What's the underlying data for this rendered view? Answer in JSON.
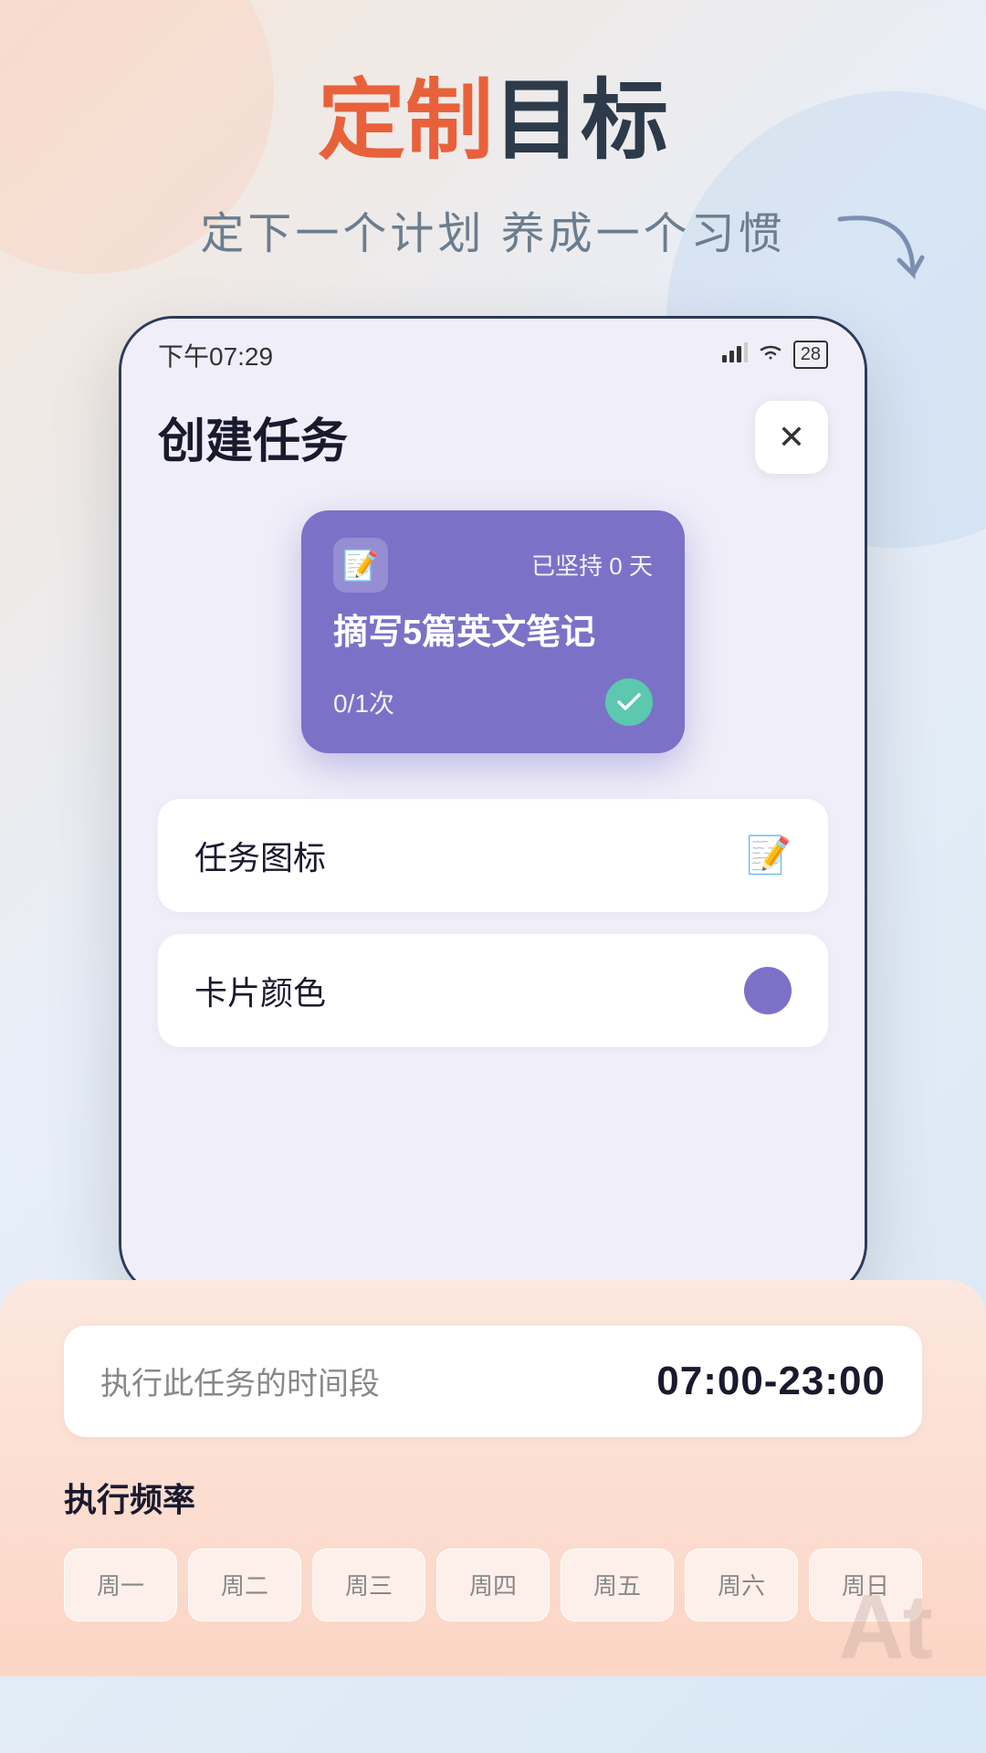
{
  "page": {
    "background_gradient": "linear-gradient(135deg, #f5e6d8 0%, #e8eef8 40%, #d8e8f5 100%)"
  },
  "header": {
    "title_part1": "定制",
    "title_part2": "目标",
    "subtitle": "定下一个计划 养成一个习惯"
  },
  "status_bar": {
    "time": "下午07:29",
    "signal": "HD",
    "wifi": "wifi",
    "battery": "28"
  },
  "app": {
    "page_title": "创建任务",
    "close_label": "×",
    "task_card": {
      "streak_label": "已坚持",
      "streak_days": "0",
      "streak_unit": "天",
      "task_name": "摘写5篇英文笔记",
      "progress_current": "0",
      "progress_total": "1",
      "progress_unit": "次"
    },
    "form_rows": [
      {
        "label": "任务图标",
        "value_type": "icon"
      },
      {
        "label": "卡片颜色",
        "value_type": "color"
      }
    ],
    "bottom_panel": {
      "time_label": "执行此任务的时间段",
      "time_value": "07:00-23:00",
      "frequency_title": "执行频率",
      "weekdays": [
        "周一",
        "周二",
        "周三",
        "周四",
        "周五",
        "周六",
        "周日"
      ]
    }
  },
  "at_text": "At"
}
